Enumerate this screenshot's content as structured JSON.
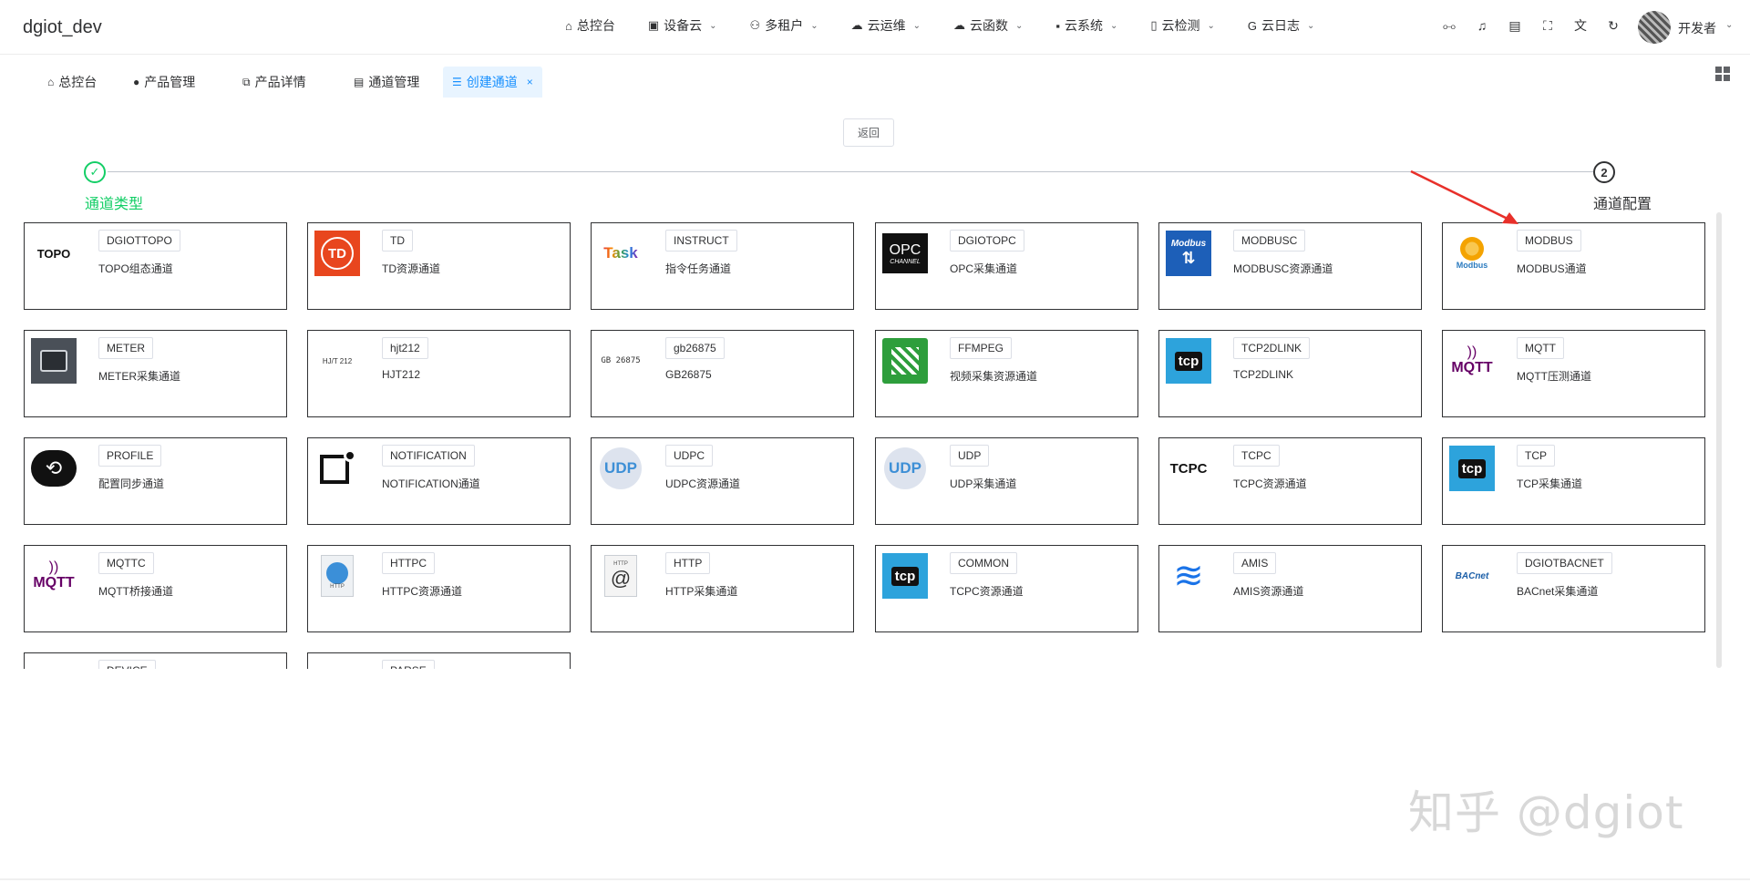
{
  "app": {
    "title": "dgiot_dev"
  },
  "nav": {
    "items": [
      {
        "label": "总控台",
        "icon": "home-icon",
        "glyph": "⌂",
        "dropdown": false
      },
      {
        "label": "设备云",
        "icon": "device-icon",
        "glyph": "▣",
        "dropdown": true
      },
      {
        "label": "多租户",
        "icon": "users-icon",
        "glyph": "⚇",
        "dropdown": true
      },
      {
        "label": "云运维",
        "icon": "cloud-icon",
        "glyph": "☁",
        "dropdown": true
      },
      {
        "label": "云函数",
        "icon": "cloud-function-icon",
        "glyph": "☁",
        "dropdown": true
      },
      {
        "label": "云系统",
        "icon": "system-icon",
        "glyph": "▪",
        "dropdown": true
      },
      {
        "label": "云检测",
        "icon": "detect-icon",
        "glyph": "▯",
        "dropdown": true
      },
      {
        "label": "云日志",
        "icon": "log-icon",
        "glyph": "G",
        "dropdown": true
      }
    ],
    "tools": [
      "tree-icon",
      "bell-icon",
      "document-icon",
      "fullscreen-icon",
      "translate-icon",
      "refresh-icon"
    ],
    "user": "开发者"
  },
  "tags": [
    {
      "label": "总控台",
      "icon": "home-icon",
      "glyph": "⌂"
    },
    {
      "label": "产品管理",
      "icon": "product-icon",
      "glyph": "●"
    },
    {
      "label": "产品详情",
      "icon": "code-icon",
      "glyph": "⧉"
    },
    {
      "label": "通道管理",
      "icon": "chart-icon",
      "glyph": "▤"
    },
    {
      "label": "创建通道",
      "icon": "list-icon",
      "glyph": "☰",
      "active": true
    }
  ],
  "back_label": "返回",
  "steps": [
    {
      "label": "通道类型",
      "number": "✓",
      "status": "done"
    },
    {
      "label": "通道配置",
      "number": "2",
      "status": "current"
    }
  ],
  "colors": {
    "accent": "#1890ff",
    "success": "#13ce66",
    "arrow": "#e8302a"
  },
  "cards": [
    {
      "name": "DGIOTTOPO",
      "desc": "TOPO组态通道",
      "logo": "topo-logo",
      "logo_text": "TOPO"
    },
    {
      "name": "TD",
      "desc": "TD资源通道",
      "logo": "td-logo",
      "logo_text": "TD"
    },
    {
      "name": "INSTRUCT",
      "desc": "指令任务通道",
      "logo": "task-logo",
      "logo_text": "Task"
    },
    {
      "name": "DGIOTOPC",
      "desc": "OPC采集通道",
      "logo": "opc-logo",
      "logo_text": "OPC"
    },
    {
      "name": "MODBUSC",
      "desc": "MODBUSC资源通道",
      "logo": "modbus-blue-logo",
      "logo_text": "Modbus"
    },
    {
      "name": "MODBUS",
      "desc": "MODBUS通道",
      "logo": "modbus-logo",
      "logo_text": "Modbus"
    },
    {
      "name": "METER",
      "desc": "METER采集通道",
      "logo": "meter-logo",
      "logo_text": ""
    },
    {
      "name": "hjt212",
      "desc": "HJT212",
      "logo": "hjt212-logo",
      "logo_text": "HJ/T 212"
    },
    {
      "name": "gb26875",
      "desc": "GB26875",
      "logo": "gb26875-logo",
      "logo_text": "GB 26875"
    },
    {
      "name": "FFMPEG",
      "desc": "视频采集资源通道",
      "logo": "ffmpeg-logo",
      "logo_text": ""
    },
    {
      "name": "TCP2DLINK",
      "desc": "TCP2DLINK",
      "logo": "tcp-logo",
      "logo_text": "tcp"
    },
    {
      "name": "MQTT",
      "desc": "MQTT压测通道",
      "logo": "mqtt-logo",
      "logo_text": "MQTT"
    },
    {
      "name": "PROFILE",
      "desc": "配置同步通道",
      "logo": "cloud-sync-logo",
      "logo_text": ""
    },
    {
      "name": "NOTIFICATION",
      "desc": "NOTIFICATION通道",
      "logo": "notification-logo",
      "logo_text": ""
    },
    {
      "name": "UDPC",
      "desc": "UDPC资源通道",
      "logo": "udp-logo",
      "logo_text": "UDP"
    },
    {
      "name": "UDP",
      "desc": "UDP采集通道",
      "logo": "udp-logo",
      "logo_text": "UDP"
    },
    {
      "name": "TCPC",
      "desc": "TCPC资源通道",
      "logo": "tcpc-logo",
      "logo_text": "TCPC"
    },
    {
      "name": "TCP",
      "desc": "TCP采集通道",
      "logo": "tcp-logo",
      "logo_text": "tcp"
    },
    {
      "name": "MQTTC",
      "desc": "MQTT桥接通道",
      "logo": "mqtt-logo",
      "logo_text": "MQTT"
    },
    {
      "name": "HTTPC",
      "desc": "HTTPC资源通道",
      "logo": "http-globe-logo",
      "logo_text": "HTTP"
    },
    {
      "name": "HTTP",
      "desc": "HTTP采集通道",
      "logo": "http-at-logo",
      "logo_text": "HTTP"
    },
    {
      "name": "COMMON",
      "desc": "TCPC资源通道",
      "logo": "tcp-logo",
      "logo_text": "tcp"
    },
    {
      "name": "AMIS",
      "desc": "AMIS资源通道",
      "logo": "amis-logo",
      "logo_text": ""
    },
    {
      "name": "DGIOTBACNET",
      "desc": "BACnet采集通道",
      "logo": "bacnet-logo",
      "logo_text": "BACnet"
    },
    {
      "name": "DEVICE",
      "desc": "",
      "logo": "device-logo",
      "logo_text": ""
    },
    {
      "name": "PARSE",
      "desc": "",
      "logo": "parse-logo",
      "logo_text": ""
    }
  ],
  "watermark": "知乎 @dgiot"
}
